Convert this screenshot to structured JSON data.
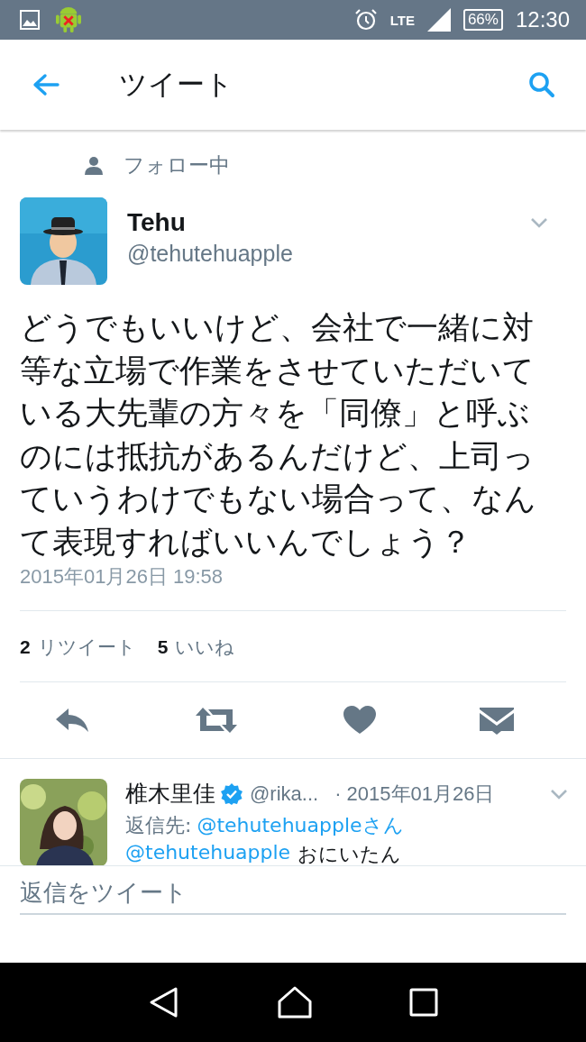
{
  "status_bar": {
    "time": "12:30",
    "battery": "66%",
    "network": "LTE"
  },
  "toolbar": {
    "title": "ツイート"
  },
  "context": {
    "label": "フォロー中"
  },
  "tweet": {
    "name": "Tehu",
    "handle": "@tehutehuapple",
    "text": "どうでもいいけど、会社で一緒に対等な立場で作業をさせていただいている大先輩の方々を「同僚」と呼ぶのには抵抗があるんだけど、上司っていうわけでもない場合って、なんて表現すればいいんでしょう？",
    "timestamp": "2015年01月26日 19:58",
    "stats": [
      {
        "count": "2",
        "label": "リツイート"
      },
      {
        "count": "5",
        "label": "いいね"
      }
    ],
    "actions": [
      {
        "kind": "reply"
      },
      {
        "kind": "retweet"
      },
      {
        "kind": "like"
      },
      {
        "kind": "message"
      }
    ]
  },
  "reply": {
    "name": "椎木里佳",
    "verified": true,
    "handle": "@rika...",
    "date": "· 2015年01月26日",
    "reply_to_label": "返信先:",
    "reply_to": "@tehutehuappleさん",
    "mention": "@tehutehuapple",
    "text": "おにいたん"
  },
  "composer": {
    "placeholder": "返信をツイート"
  }
}
